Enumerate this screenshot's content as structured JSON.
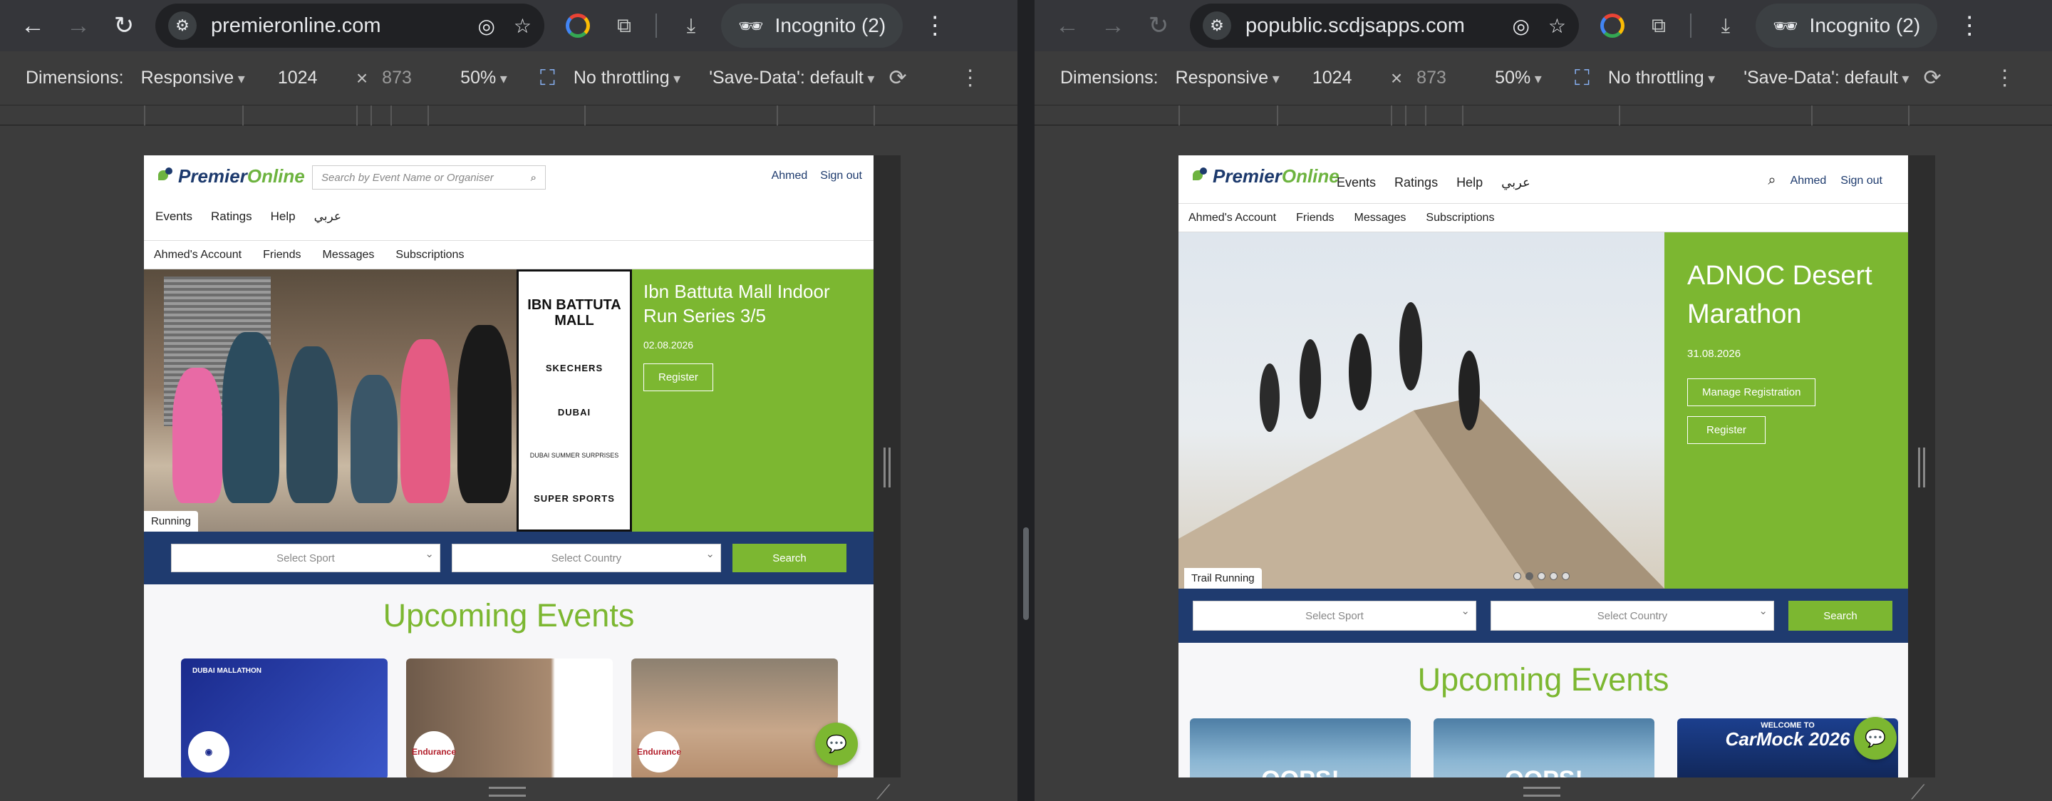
{
  "left": {
    "url": "premieronline.com",
    "incognito": "Incognito (2)",
    "devtools": {
      "label": "Dimensions:",
      "mode": "Responsive",
      "width": "1024",
      "height": "873",
      "zoom": "50%",
      "throttle": "No throttling",
      "savedata": "'Save-Data': default"
    },
    "site": {
      "logo_a": "Premier",
      "logo_b": "Online",
      "search_placeholder": "Search by Event Name or Organiser",
      "user": "Ahmed",
      "signout": "Sign out",
      "nav": [
        "Events",
        "Ratings",
        "Help",
        "عربي"
      ],
      "subnav": [
        "Ahmed's Account",
        "Friends",
        "Messages",
        "Subscriptions"
      ],
      "sponsors": {
        "s1": "IBN BATTUTA MALL",
        "s2": "SKECHERS",
        "s3": "DUBAI",
        "s4": "DUBAI SUMMER SURPRISES",
        "s5": "SUPER SPORTS"
      },
      "hero_title": "Ibn Battuta Mall Indoor Run Series 3/5",
      "hero_date": "02.08.2026",
      "hero_register": "Register",
      "hero_tag": "Running",
      "select_sport": "Select Sport",
      "select_country": "Select Country",
      "search_btn": "Search",
      "upcoming": "Upcoming Events",
      "card1_title": "DUBAI MALLATHON",
      "card2_badge": "Endurance",
      "card3_badge": "Endurance"
    }
  },
  "right": {
    "url": "popublic.scdjsapps.com",
    "incognito": "Incognito (2)",
    "devtools": {
      "label": "Dimensions:",
      "mode": "Responsive",
      "width": "1024",
      "height": "873",
      "zoom": "50%",
      "throttle": "No throttling",
      "savedata": "'Save-Data': default"
    },
    "site": {
      "logo_a": "Premier",
      "logo_b": "Online",
      "nav": [
        "Events",
        "Ratings",
        "Help",
        "عربي"
      ],
      "user": "Ahmed",
      "signout": "Sign out",
      "subnav": [
        "Ahmed's Account",
        "Friends",
        "Messages",
        "Subscriptions"
      ],
      "hero_title": "ADNOC Desert Marathon",
      "hero_date": "31.08.2026",
      "hero_manage": "Manage Registration",
      "hero_register": "Register",
      "hero_tag": "Trail Running",
      "select_sport": "Select Sport",
      "select_country": "Select Country",
      "search_btn": "Search",
      "upcoming": "Upcoming Events",
      "card1": "OOPS!",
      "card2": "OOPS!",
      "card3_top": "WELCOME TO",
      "card3_title": "CarMock 2026"
    }
  }
}
